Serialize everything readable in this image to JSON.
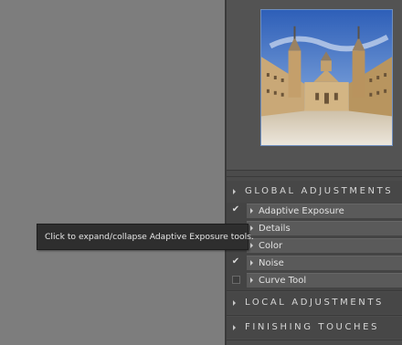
{
  "global_adjustments": {
    "label": "GLOBAL ADJUSTMENTS",
    "tools": [
      {
        "label": "Adaptive Exposure",
        "checked": true
      },
      {
        "label": "Details",
        "checked": false
      },
      {
        "label": "Color",
        "checked": false
      },
      {
        "label": "Noise",
        "checked": true
      },
      {
        "label": "Curve Tool",
        "checked": false,
        "checkbox_visible": true
      }
    ]
  },
  "local_adjustments": {
    "label": "LOCAL ADJUSTMENTS"
  },
  "finishing_touches": {
    "label": "FINISHING TOUCHES"
  },
  "tooltip": {
    "text": "Click to expand/collapse Adaptive Exposure tools."
  },
  "icons": {
    "checkmark": "✔",
    "expand": "triangle-right-icon",
    "collapse": "triangle-down-icon"
  },
  "colors": {
    "panel": "#4b4b4b",
    "canvas": "#7d7d7d",
    "thumb_border": "#6f8fbf"
  }
}
